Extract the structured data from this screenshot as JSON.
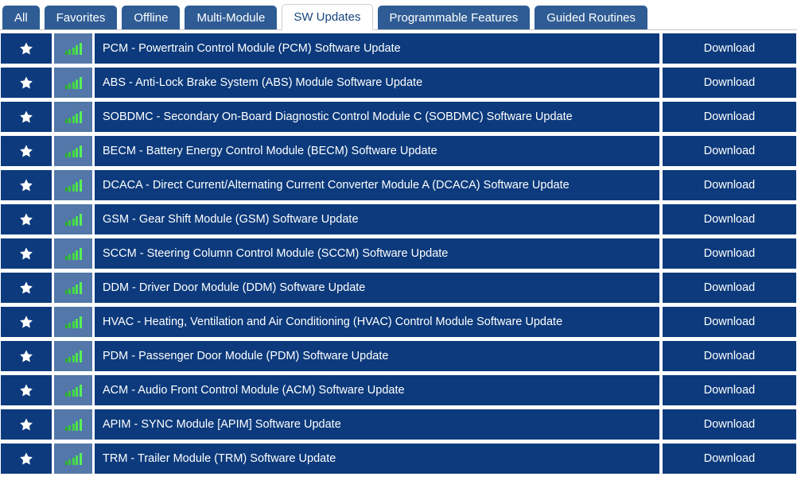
{
  "tabs": [
    {
      "label": "All",
      "active": false
    },
    {
      "label": "Favorites",
      "active": false
    },
    {
      "label": "Offline",
      "active": false
    },
    {
      "label": "Multi-Module",
      "active": false
    },
    {
      "label": "SW Updates",
      "active": true
    },
    {
      "label": "Programmable Features",
      "active": false
    },
    {
      "label": "Guided Routines",
      "active": false
    }
  ],
  "icons": {
    "favorite": "star-icon",
    "signal": "signal-strength-icon"
  },
  "colors": {
    "row_background": "#0c3a7c",
    "signal_cell_background": "#5277a8",
    "tab_inactive": "#2f5c94",
    "tab_active_text": "#17457e",
    "signal_green": "#3ddb3d",
    "page_background": "#ffffff"
  },
  "action_label": "Download",
  "rows": [
    {
      "name": "PCM - Powertrain Control Module (PCM) Software Update",
      "action": "Download"
    },
    {
      "name": "ABS - Anti-Lock Brake System (ABS) Module Software Update",
      "action": "Download"
    },
    {
      "name": "SOBDMC - Secondary On-Board Diagnostic Control Module C (SOBDMC) Software Update",
      "action": "Download"
    },
    {
      "name": "BECM - Battery Energy Control Module (BECM) Software Update",
      "action": "Download"
    },
    {
      "name": "DCACA - Direct Current/Alternating Current Converter Module A (DCACA) Software Update",
      "action": "Download"
    },
    {
      "name": "GSM - Gear Shift Module (GSM) Software Update",
      "action": "Download"
    },
    {
      "name": "SCCM - Steering Column Control Module (SCCM) Software Update",
      "action": "Download"
    },
    {
      "name": "DDM - Driver Door Module (DDM) Software Update",
      "action": "Download"
    },
    {
      "name": "HVAC - Heating, Ventilation and Air Conditioning (HVAC) Control Module Software Update",
      "action": "Download"
    },
    {
      "name": "PDM - Passenger Door Module (PDM) Software Update",
      "action": "Download"
    },
    {
      "name": "ACM - Audio Front Control Module (ACM) Software Update",
      "action": "Download"
    },
    {
      "name": "APIM - SYNC Module [APIM] Software Update",
      "action": "Download"
    },
    {
      "name": "TRM - Trailer Module (TRM) Software Update",
      "action": "Download"
    }
  ]
}
